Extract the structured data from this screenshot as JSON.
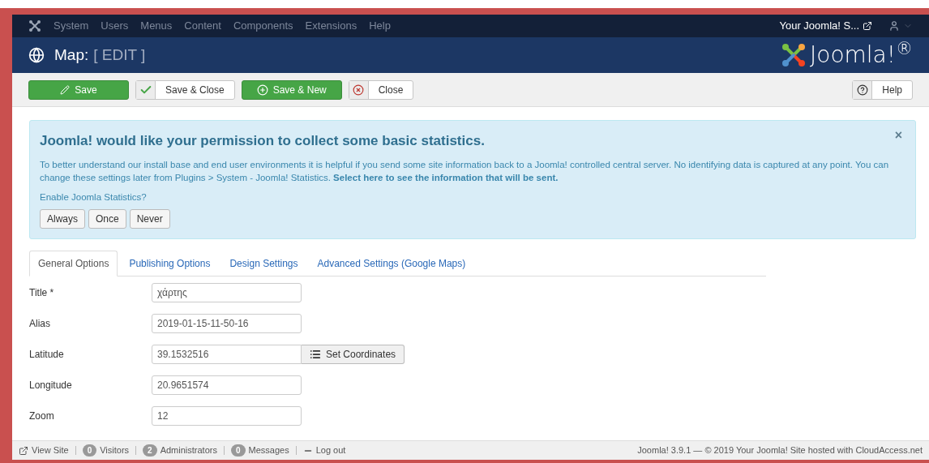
{
  "menu": {
    "items": [
      "System",
      "Users",
      "Menus",
      "Content",
      "Components",
      "Extensions",
      "Help"
    ],
    "site_link": "Your Joomla! S..."
  },
  "header": {
    "title": "Map:",
    "subtitle": "[ EDIT ]",
    "logo": "Joomla!$^{®}$"
  },
  "toolbar": {
    "buttons": [
      {
        "label": "Save",
        "kind": "primary"
      },
      {
        "label": "Save & Close",
        "kind": "default"
      },
      {
        "label": "Save & New",
        "kind": "primary"
      },
      {
        "label": "Close",
        "kind": "default"
      }
    ],
    "help": "Help"
  },
  "alert": {
    "dismiss": "×",
    "heading": "Joomla! would like your permission to collect some basic statistics.",
    "body": "To better understand our install base and end user environments it is helpful if you send some site information back to a Joomla! controlled central server. No identifying data is captured at any point. You can change these settings later from Plugins > System - Joomla! Statistics. **Select here to see the information that will be sent.**",
    "question": "Enable Joomla Statistics?",
    "buttons": [
      "Always",
      "Once",
      "Never"
    ]
  },
  "tabs": [
    {
      "label": "General Options",
      "selected": true
    },
    {
      "label": "Publishing Options",
      "selected": false
    },
    {
      "label": "Design Settings",
      "selected": false
    },
    {
      "label": "Advanced Settings (Google Maps)",
      "selected": false
    }
  ],
  "fields": [
    {
      "label": "Title *",
      "value": "χάρτης"
    },
    {
      "label": "Alias",
      "value": "2019-01-15-11-50-16"
    },
    {
      "label": "Latitude",
      "value": "39.1532516",
      "button": "Set Coordinates"
    },
    {
      "label": "Longitude",
      "value": "20.9651574"
    },
    {
      "label": "Zoom",
      "value": "12"
    }
  ],
  "status_bar": {
    "view_site": "View Site",
    "items": [
      {
        "count": "0",
        "label": "Visitors"
      },
      {
        "count": "2",
        "label": "Administrators"
      },
      {
        "count": "0",
        "label": "Messages"
      }
    ],
    "logout": "Log out",
    "footer": "Joomla! 3.9.1 — © 2019 Your Joomla! Site hosted with CloudAccess.net"
  }
}
